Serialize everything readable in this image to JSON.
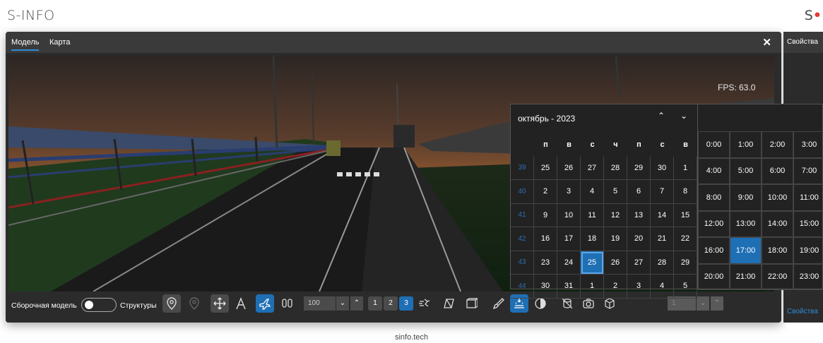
{
  "brand": {
    "left": "S-INFO",
    "right_letter": "S",
    "right_dot": "•"
  },
  "footer": "sinfo.tech",
  "window": {
    "tabs": [
      {
        "label": "Модель",
        "active": true
      },
      {
        "label": "Карта",
        "active": false
      }
    ],
    "close_label": "✕",
    "fps": "FPS: 63.0"
  },
  "right_panel": {
    "header": "Свойства",
    "footer": "Свойства"
  },
  "toolbar": {
    "assembly_label": "Сборочная модель",
    "structures_label": "Структуры",
    "zoom_value": "100",
    "levels": [
      "1",
      "2",
      "3"
    ],
    "active_level": "3",
    "level_field": "1"
  },
  "calendar": {
    "month": "октябрь - 2023",
    "weekdays": [
      "п",
      "в",
      "с",
      "ч",
      "п",
      "с",
      "в"
    ],
    "weeks": [
      {
        "week": "39",
        "days": [
          "25",
          "26",
          "27",
          "28",
          "29",
          "30",
          "1"
        ]
      },
      {
        "week": "40",
        "days": [
          "2",
          "3",
          "4",
          "5",
          "6",
          "7",
          "8"
        ]
      },
      {
        "week": "41",
        "days": [
          "9",
          "10",
          "11",
          "12",
          "13",
          "14",
          "15"
        ]
      },
      {
        "week": "42",
        "days": [
          "16",
          "17",
          "18",
          "19",
          "20",
          "21",
          "22"
        ]
      },
      {
        "week": "43",
        "days": [
          "23",
          "24",
          "25",
          "26",
          "27",
          "28",
          "29"
        ]
      },
      {
        "week": "44",
        "days": [
          "30",
          "31",
          "1",
          "2",
          "3",
          "4",
          "5"
        ]
      }
    ],
    "selected_day": "25"
  },
  "time": {
    "hours": [
      "0:00",
      "1:00",
      "2:00",
      "3:00",
      "4:00",
      "5:00",
      "6:00",
      "7:00",
      "8:00",
      "9:00",
      "10:00",
      "11:00",
      "12:00",
      "13:00",
      "14:00",
      "15:00",
      "16:00",
      "17:00",
      "18:00",
      "19:00",
      "20:00",
      "21:00",
      "22:00",
      "23:00"
    ],
    "selected": "17:00"
  },
  "colors": {
    "accent": "#1f6fb5",
    "panel": "#2b2b2b",
    "logo_dot": "#e53935"
  }
}
